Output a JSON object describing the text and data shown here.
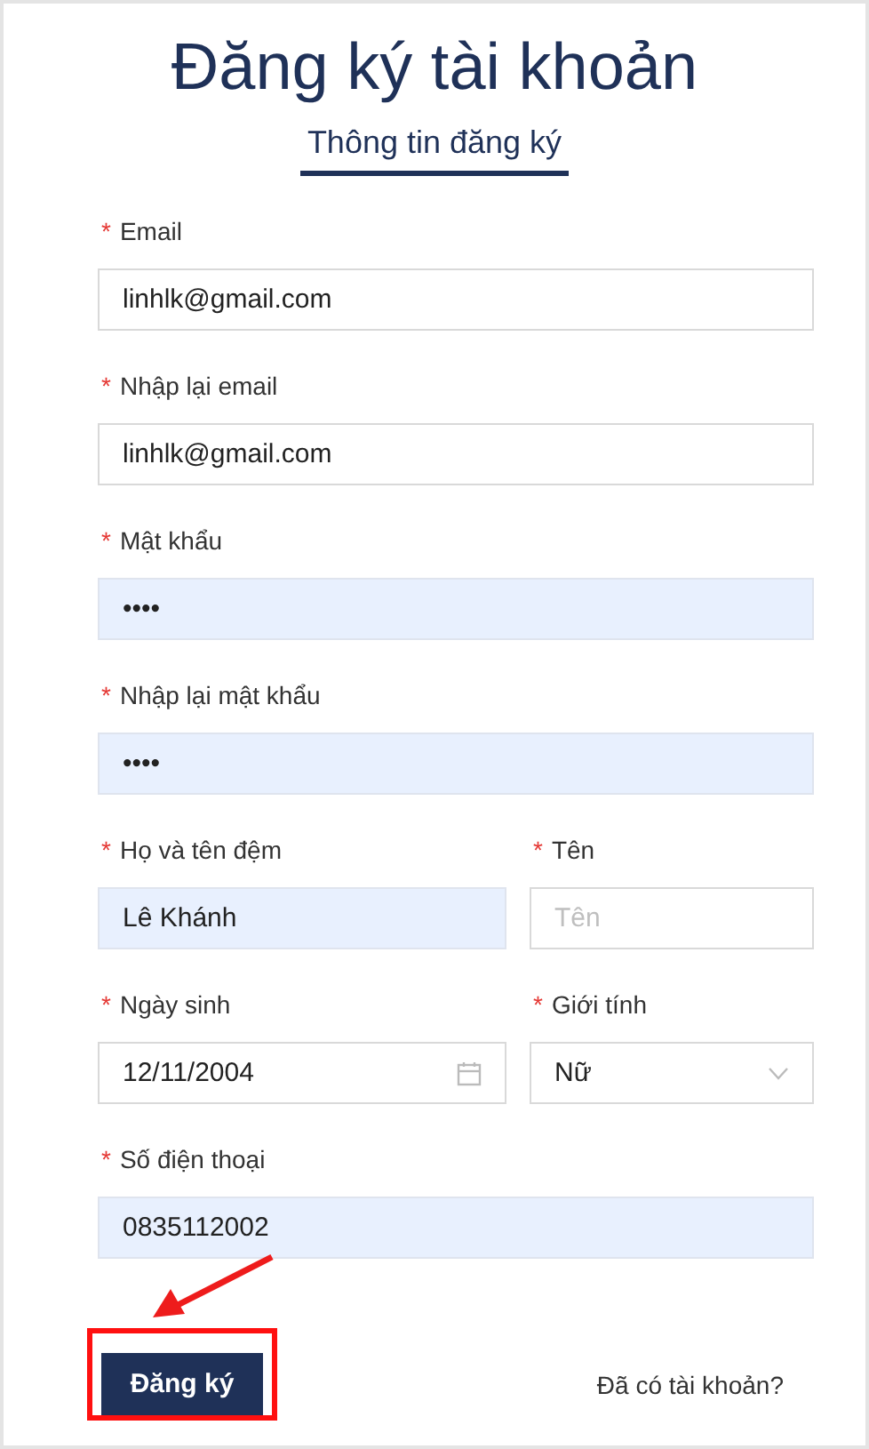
{
  "title": "Đăng ký tài khoản",
  "tabs": [
    {
      "label": "Thông tin đăng ký",
      "selected": true
    }
  ],
  "rows": [
    {
      "fields": [
        {
          "label": "Email",
          "required": true,
          "marker": "*",
          "kind": "text",
          "value": "linhlk@gmail.com",
          "autofilled": false
        }
      ]
    },
    {
      "fields": [
        {
          "label": "Nhập lại email",
          "required": true,
          "marker": "*",
          "kind": "text",
          "value": "linhlk@gmail.com",
          "autofilled": false
        }
      ]
    },
    {
      "fields": [
        {
          "label": "Mật khẩu",
          "required": true,
          "marker": "*",
          "kind": "text",
          "value": "••••",
          "autofilled": true
        }
      ]
    },
    {
      "fields": [
        {
          "label": "Nhập lại mật khẩu",
          "required": true,
          "marker": "*",
          "kind": "text",
          "value": "••••",
          "autofilled": true
        }
      ]
    },
    {
      "fields": [
        {
          "label": "Họ và tên đệm",
          "required": true,
          "marker": "*",
          "kind": "text",
          "value": "Lê Khánh",
          "autofilled": true
        },
        {
          "label": "Tên",
          "required": true,
          "marker": "*",
          "kind": "text",
          "placeholder": "Tên",
          "autofilled": false
        }
      ]
    },
    {
      "fields": [
        {
          "label": "Ngày sinh",
          "required": true,
          "marker": "*",
          "kind": "date",
          "value": "12/11/2004",
          "autofilled": false
        },
        {
          "label": "Giới tính",
          "required": true,
          "marker": "*",
          "kind": "select",
          "value": "Nữ",
          "autofilled": false
        }
      ]
    },
    {
      "fields": [
        {
          "label": "Số điện thoại",
          "required": true,
          "marker": "*",
          "kind": "text",
          "value": "0835112002",
          "autofilled": true
        }
      ]
    }
  ],
  "submit": "Đăng ký",
  "login_link": "Đã có tài khoản?",
  "annotations": {
    "highlight_frame": true,
    "arrow": true
  }
}
